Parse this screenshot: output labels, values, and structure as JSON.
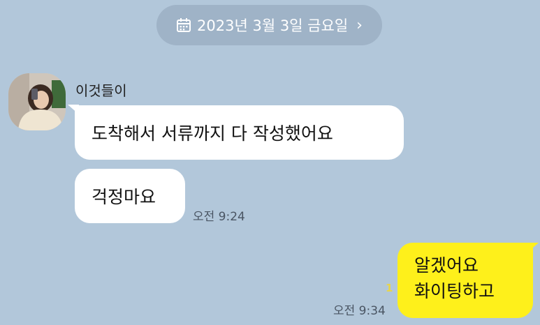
{
  "date_header": {
    "text": "2023년 3월 3일 금요일",
    "icon": "calendar-icon",
    "chevron": "›"
  },
  "messages": [
    {
      "sender": "이것들이",
      "avatar_icon": "profile-photo",
      "bubbles": [
        "도착해서 서류까지 다 작성했어요",
        "걱정마요"
      ],
      "time": "오전 9:24"
    },
    {
      "sender": "me",
      "lines": [
        "알겠어요",
        "화이팅하고"
      ],
      "unread_count": "1",
      "time": "오전 9:34"
    }
  ],
  "colors": {
    "background": "#b2c7da",
    "date_pill": "#9fb3c7",
    "incoming_bubble": "#ffffff",
    "outgoing_bubble": "#fef01b",
    "unread": "#e8d54a"
  }
}
